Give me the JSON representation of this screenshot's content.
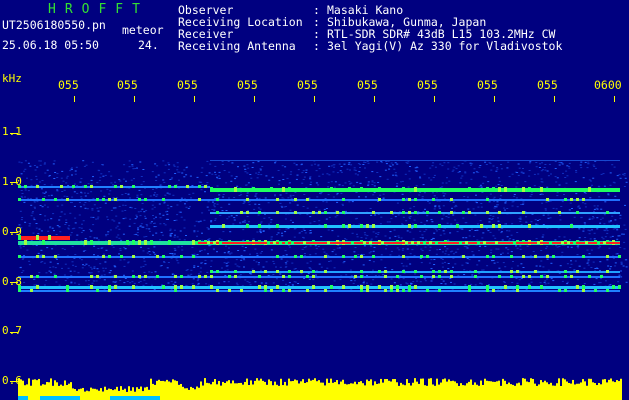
{
  "header": {
    "app_title": "HROFFT",
    "file_name": "UT2506180550.pn",
    "detection_type": "meteor",
    "datetime": "25.06.18 05:50",
    "frame_number": "24.",
    "info": [
      {
        "label": "Observer",
        "value": "Masaki Kano"
      },
      {
        "label": "Receiving Location",
        "value": "Shibukawa, Gunma, Japan"
      },
      {
        "label": "Receiver",
        "value": "RTL-SDR SDR# 43dB L15 103.2MHz CW"
      },
      {
        "label": "Receiving Antenna",
        "value": "3el Yagi(V) Az 330 for Vladivostok"
      }
    ]
  },
  "axis": {
    "y_unit": "kHz",
    "y_ticks": [
      "1.1",
      "1.0",
      "0.9",
      "0.8",
      "0.7",
      "0.6"
    ],
    "x_ticks": [
      "055",
      "055",
      "055",
      "055",
      "055",
      "055",
      "055",
      "055",
      "055",
      "0600"
    ]
  },
  "colors": {
    "background": "#000080",
    "axis_text": "#ffff00",
    "header_text": "#ffffff",
    "title_text": "#33e033",
    "signal_strong": "#ff2020",
    "signal_mid": "#20ff60",
    "signal_weak": "#20a0ff",
    "noise_bar": "#ffff00"
  }
}
